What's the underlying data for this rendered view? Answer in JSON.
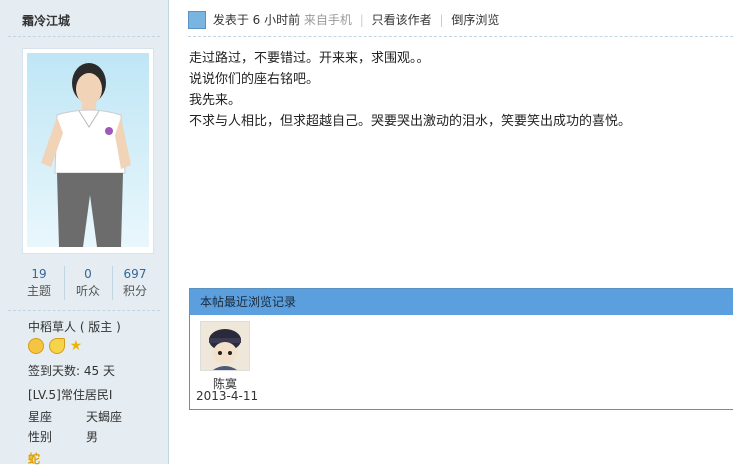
{
  "author": {
    "username": "霜冷江城",
    "stats": [
      {
        "num": "19",
        "label": "主题"
      },
      {
        "num": "0",
        "label": "听众"
      },
      {
        "num": "697",
        "label": "积分"
      }
    ],
    "group": "中稻草人 ( 版主 )",
    "medal_icons": [
      "sun-icon",
      "moon-icon",
      "star-icon"
    ],
    "signin_days": "签到天数: 45 天",
    "level": "[LV.5]常住居民I",
    "info": [
      {
        "label": "星座",
        "value": "天蝎座"
      },
      {
        "label": "性别",
        "value": "男"
      }
    ],
    "extra": "蛇"
  },
  "post": {
    "posted": "发表于 6 小时前",
    "source": "来自手机",
    "author_only": "只看该作者",
    "reverse": "倒序浏览",
    "lines": [
      "走过路过，不要错过。开来来，求围观。。",
      "说说你们的座右铭吧。",
      "我先来。",
      "不求与人相比，但求超越自己。哭要哭出激动的泪水，笑要笑出成功的喜悦。"
    ]
  },
  "recent": {
    "title": "本帖最近浏览记录",
    "visitors": [
      {
        "name": "陈寞",
        "date": "2013-4-11"
      }
    ]
  },
  "colors": {
    "sidebar_bg": "#e5edf2",
    "header_blue": "#5b9fdf",
    "link_blue": "#336699"
  }
}
